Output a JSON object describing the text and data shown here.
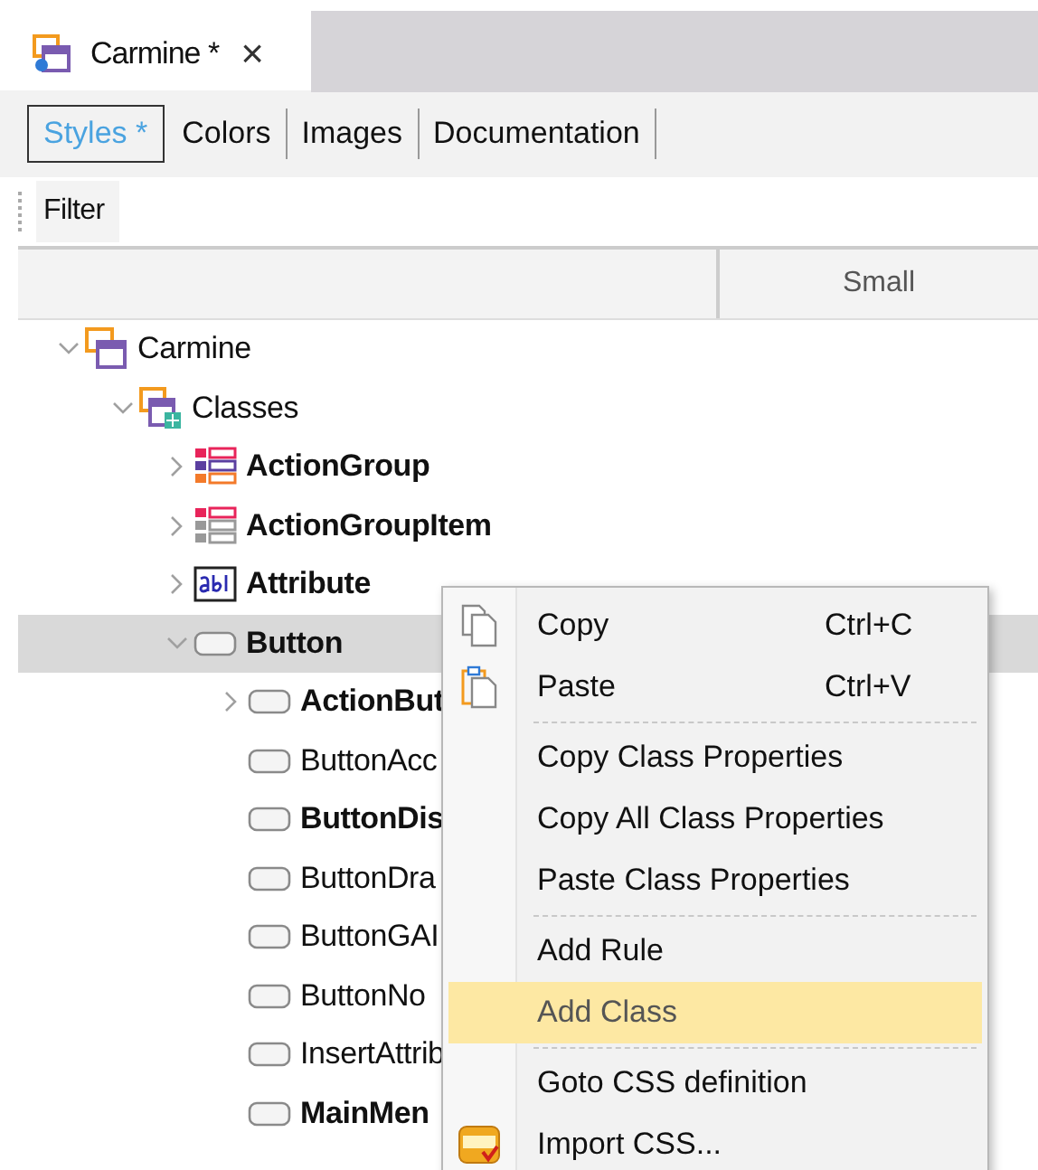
{
  "document_tab": {
    "title": "Carmine *",
    "close": "×"
  },
  "subtabs": [
    {
      "label": "Styles *",
      "selected": true
    },
    {
      "label": "Colors",
      "selected": false
    },
    {
      "label": "Images",
      "selected": false
    },
    {
      "label": "Documentation",
      "selected": false
    }
  ],
  "filter": {
    "label": "Filter"
  },
  "columns": {
    "column_2": "Small"
  },
  "tree": [
    {
      "label": "Carmine",
      "kind": "module",
      "expandable": true,
      "expanded": true,
      "bold": false,
      "selected": false,
      "children": [
        {
          "label": "Classes",
          "kind": "classes",
          "expandable": true,
          "expanded": true,
          "bold": false,
          "selected": false,
          "children": [
            {
              "label": "ActionGroup",
              "kind": "action-group",
              "expandable": true,
              "expanded": false,
              "bold": true,
              "selected": false
            },
            {
              "label": "ActionGroupItem",
              "kind": "action-group-item",
              "expandable": true,
              "expanded": false,
              "bold": true,
              "selected": false
            },
            {
              "label": "Attribute",
              "kind": "attribute",
              "expandable": true,
              "expanded": false,
              "bold": true,
              "selected": false
            },
            {
              "label": "Button",
              "kind": "button",
              "expandable": true,
              "expanded": true,
              "bold": true,
              "selected": true,
              "children": [
                {
                  "label": "ActionBut",
                  "kind": "button",
                  "expandable": true,
                  "expanded": false,
                  "bold": true,
                  "selected": false
                },
                {
                  "label": "ButtonAcc",
                  "kind": "button",
                  "expandable": false,
                  "bold": false,
                  "selected": false
                },
                {
                  "label": "ButtonDis",
                  "kind": "button",
                  "expandable": false,
                  "bold": true,
                  "selected": false
                },
                {
                  "label": "ButtonDra",
                  "kind": "button",
                  "expandable": false,
                  "bold": false,
                  "selected": false
                },
                {
                  "label": "ButtonGAI",
                  "kind": "button",
                  "expandable": false,
                  "bold": false,
                  "selected": false
                },
                {
                  "label": "ButtonNo",
                  "kind": "button",
                  "expandable": false,
                  "bold": false,
                  "selected": false
                },
                {
                  "label": "InsertAttrib",
                  "kind": "button",
                  "expandable": false,
                  "bold": false,
                  "selected": false
                },
                {
                  "label": "MainMen",
                  "kind": "button",
                  "expandable": false,
                  "bold": true,
                  "selected": false
                }
              ]
            }
          ]
        }
      ]
    }
  ],
  "context_menu": [
    {
      "label": "Copy",
      "shortcut": "Ctrl+C",
      "kind": "copy",
      "separator_before": false,
      "selected": false
    },
    {
      "label": "Paste",
      "shortcut": "Ctrl+V",
      "kind": "paste",
      "separator_before": false,
      "selected": false
    },
    {
      "label": "Copy Class Properties",
      "kind": "plain",
      "separator_before": true,
      "selected": false
    },
    {
      "label": "Copy All Class Properties",
      "kind": "plain",
      "separator_before": false,
      "selected": false
    },
    {
      "label": "Paste Class Properties",
      "kind": "plain",
      "separator_before": false,
      "selected": false
    },
    {
      "label": "Add Rule",
      "kind": "plain",
      "separator_before": true,
      "selected": false
    },
    {
      "label": "Add Class",
      "kind": "plain",
      "separator_before": false,
      "selected": true
    },
    {
      "label": "Goto CSS definition",
      "kind": "plain",
      "separator_before": true,
      "selected": false
    },
    {
      "label": "Import CSS...",
      "kind": "css",
      "separator_before": false,
      "selected": false
    }
  ]
}
